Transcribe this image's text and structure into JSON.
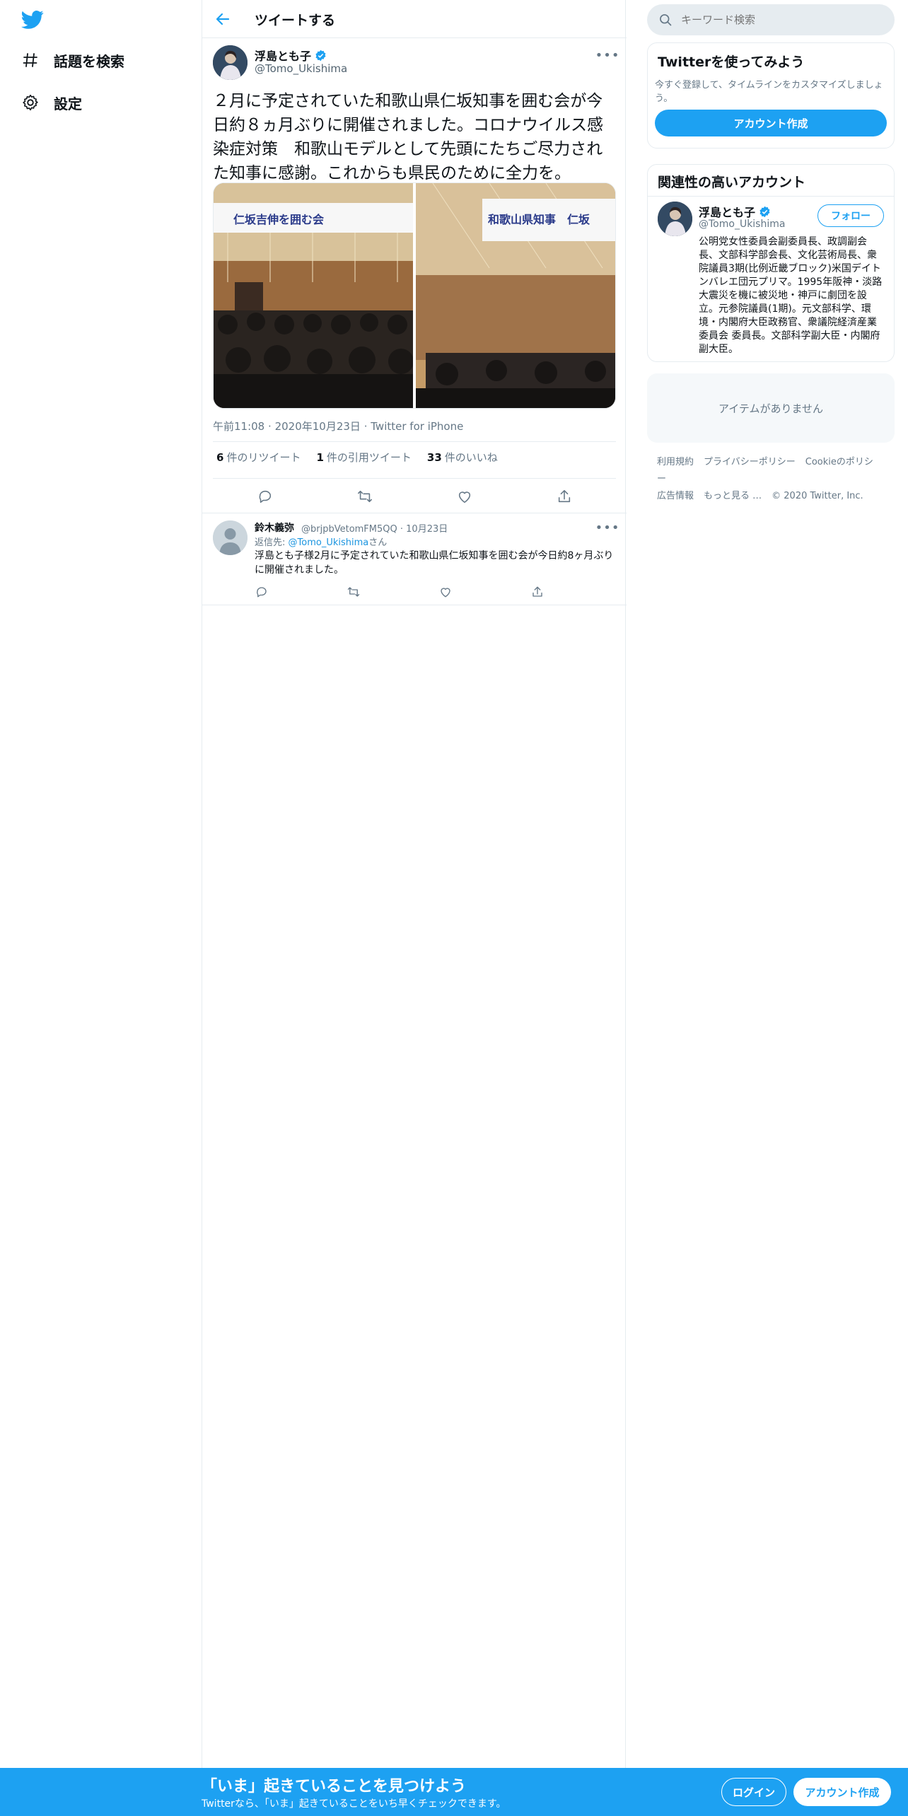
{
  "nav": {
    "logo": "twitter-bird-icon",
    "items": [
      {
        "label": "話題を検索",
        "icon": "hashtag-icon"
      },
      {
        "label": "設定",
        "icon": "gear-icon"
      }
    ]
  },
  "header": {
    "title": "ツイートする"
  },
  "tweet": {
    "name": "浮島とも子",
    "handle": "@Tomo_Ukishima",
    "text": "２月に予定されていた和歌山県仁坂知事を囲む会が今日約８ヵ月ぶりに開催されました。コロナウイルス感染症対策　和歌山モデルとして先頭にたちご尽力された知事に感謝。これからも県民のために全力を。",
    "media_banner_left": "仁坂吉伸を囲む会",
    "media_banner_right": "和歌山県知事　仁坂",
    "time": "午前11:08",
    "date": "2020年10月23日",
    "source": "Twitter for iPhone",
    "retweets": {
      "count": "6",
      "label": "件のリツイート"
    },
    "quotes": {
      "count": "1",
      "label": "件の引用ツイート"
    },
    "likes": {
      "count": "33",
      "label": "件のいいね"
    }
  },
  "reply": {
    "name": "鈴木義弥",
    "handle": "@brjpbVetomFM5QQ",
    "date": "10月23日",
    "reply_prefix": "返信先: ",
    "reply_to": "@Tomo_Ukishima",
    "reply_suffix": "さん",
    "text": "浮島とも子様2月に予定されていた和歌山県仁坂知事を囲む会が今日約8ヶ月ぶりに開催されました。"
  },
  "sidebar": {
    "search_placeholder": "キーワード検索",
    "signup_card": {
      "title": "Twitterを使ってみよう",
      "subtitle": "今すぐ登録して、タイムラインをカスタマイズしましょう。",
      "button": "アカウント作成"
    },
    "related": {
      "title": "関連性の高いアカウント",
      "name": "浮島とも子",
      "handle": "@Tomo_Ukishima",
      "follow": "フォロー",
      "bio": "公明党女性委員会副委員長、政調副会長、文部科学部会長、文化芸術局長、衆院議員3期(比例近畿ブロック)米国デイトンバレエ団元プリマ。1995年阪神・淡路大震災を機に被災地・神戸に劇団を設立。元参院議員(1期)。元文部科学、環境・内閣府大臣政務官、衆議院経済産業委員会 委員長。文部科学副大臣・内閣府副大臣。"
    },
    "empty": "アイテムがありません",
    "footer": [
      "利用規約",
      "プライバシーポリシー",
      "Cookieのポリシー",
      "広告情報",
      "もっと見る …",
      "© 2020 Twitter, Inc."
    ]
  },
  "bottombar": {
    "title": "「いま」起きていることを見つけよう",
    "subtitle": "Twitterなら、「いま」起きていることをいち早くチェックできます。",
    "login": "ログイン",
    "signup": "アカウント作成"
  },
  "colors": {
    "accent": "#1da1f2",
    "border": "#e6ecf0",
    "muted": "#657786"
  }
}
